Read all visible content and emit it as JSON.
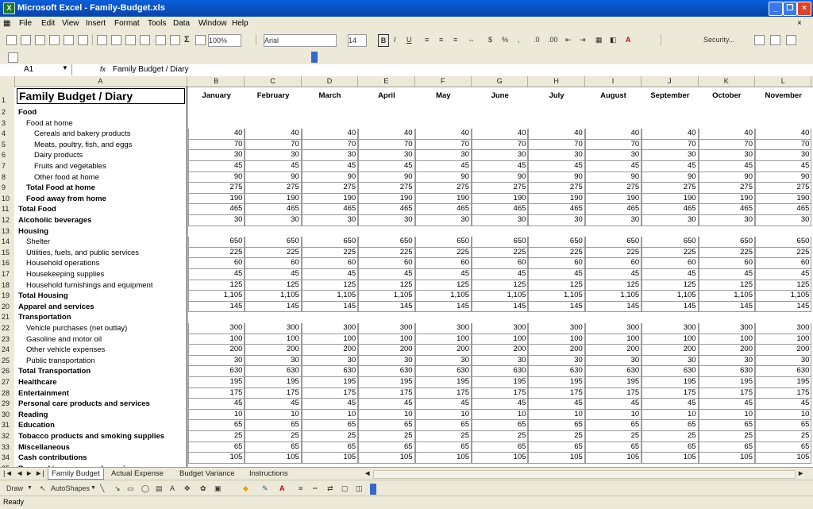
{
  "window": {
    "title": "Microsoft Excel - Family-Budget.xls",
    "icon": "excel-icon"
  },
  "menu": [
    "File",
    "Edit",
    "View",
    "Insert",
    "Format",
    "Tools",
    "Data",
    "Window",
    "Help"
  ],
  "toolbar": {
    "zoom": "100%",
    "font": "Arial",
    "font_size": "14",
    "security": "Security..."
  },
  "formula": {
    "cell_ref": "A1",
    "fx": "fx",
    "content": "Family Budget / Diary"
  },
  "columns": [
    "A",
    "B",
    "C",
    "D",
    "E",
    "F",
    "G",
    "H",
    "I",
    "J",
    "K",
    "L"
  ],
  "months": [
    "January",
    "February",
    "March",
    "April",
    "May",
    "June",
    "July",
    "August",
    "September",
    "October",
    "November"
  ],
  "title": "Family Budget / Diary",
  "rows": [
    {
      "n": "2",
      "label": "Food",
      "bold": true,
      "indent": 0,
      "value": ""
    },
    {
      "n": "3",
      "label": "Food at home",
      "bold": false,
      "indent": 1,
      "value": ""
    },
    {
      "n": "4",
      "label": "Cereals and bakery products",
      "bold": false,
      "indent": 2,
      "value": "40"
    },
    {
      "n": "5",
      "label": "Meats, poultry, fish, and eggs",
      "bold": false,
      "indent": 2,
      "value": "70"
    },
    {
      "n": "6",
      "label": "Dairy products",
      "bold": false,
      "indent": 2,
      "value": "30"
    },
    {
      "n": "7",
      "label": "Fruits and vegetables",
      "bold": false,
      "indent": 2,
      "value": "45"
    },
    {
      "n": "8",
      "label": "Other food at home",
      "bold": false,
      "indent": 2,
      "value": "90"
    },
    {
      "n": "9",
      "label": "Total Food at home",
      "bold": true,
      "indent": 1,
      "value": "275"
    },
    {
      "n": "10",
      "label": "Food away from home",
      "bold": true,
      "indent": 1,
      "value": "190"
    },
    {
      "n": "11",
      "label": "Total Food",
      "bold": true,
      "indent": 0,
      "value": "465"
    },
    {
      "n": "12",
      "label": "Alcoholic beverages",
      "bold": true,
      "indent": 0,
      "value": "30"
    },
    {
      "n": "13",
      "label": "Housing",
      "bold": true,
      "indent": 0,
      "value": ""
    },
    {
      "n": "14",
      "label": "Shelter",
      "bold": false,
      "indent": 1,
      "value": "650"
    },
    {
      "n": "15",
      "label": "Utilities, fuels, and public services",
      "bold": false,
      "indent": 1,
      "value": "225"
    },
    {
      "n": "16",
      "label": "Household operations",
      "bold": false,
      "indent": 1,
      "value": "60"
    },
    {
      "n": "17",
      "label": "Housekeeping supplies",
      "bold": false,
      "indent": 1,
      "value": "45"
    },
    {
      "n": "18",
      "label": "Household furnishings and equipment",
      "bold": false,
      "indent": 1,
      "value": "125"
    },
    {
      "n": "19",
      "label": "Total Housing",
      "bold": true,
      "indent": 0,
      "value": "1,105"
    },
    {
      "n": "20",
      "label": "Apparel and services",
      "bold": true,
      "indent": 0,
      "value": "145"
    },
    {
      "n": "21",
      "label": "Transportation",
      "bold": true,
      "indent": 0,
      "value": ""
    },
    {
      "n": "22",
      "label": "Vehicle purchases (net outlay)",
      "bold": false,
      "indent": 1,
      "value": "300"
    },
    {
      "n": "23",
      "label": "Gasoline and motor oil",
      "bold": false,
      "indent": 1,
      "value": "100"
    },
    {
      "n": "24",
      "label": "Other vehicle expenses",
      "bold": false,
      "indent": 1,
      "value": "200"
    },
    {
      "n": "25",
      "label": "Public transportation",
      "bold": false,
      "indent": 1,
      "value": "30"
    },
    {
      "n": "26",
      "label": "Total Transportation",
      "bold": true,
      "indent": 0,
      "value": "630"
    },
    {
      "n": "27",
      "label": "Healthcare",
      "bold": true,
      "indent": 0,
      "value": "195"
    },
    {
      "n": "28",
      "label": "Entertainment",
      "bold": true,
      "indent": 0,
      "value": "175"
    },
    {
      "n": "29",
      "label": "Personal care products and services",
      "bold": true,
      "indent": 0,
      "value": "45"
    },
    {
      "n": "30",
      "label": "Reading",
      "bold": true,
      "indent": 0,
      "value": "10"
    },
    {
      "n": "31",
      "label": "Education",
      "bold": true,
      "indent": 0,
      "value": "65"
    },
    {
      "n": "32",
      "label": "Tobacco products and smoking supplies",
      "bold": true,
      "indent": 0,
      "value": "25"
    },
    {
      "n": "33",
      "label": "Miscellaneous",
      "bold": true,
      "indent": 0,
      "value": "65"
    },
    {
      "n": "34",
      "label": "Cash contributions",
      "bold": true,
      "indent": 0,
      "value": "105"
    },
    {
      "n": "35",
      "label": "Personal insurance and pensions",
      "bold": true,
      "indent": 0,
      "value": ""
    }
  ],
  "sheet_tabs": [
    "Family Budget",
    "Actual Expense",
    "Budget Variance",
    "Instructions"
  ],
  "drawbar": {
    "draw": "Draw",
    "autoshapes": "AutoShapes"
  },
  "status": "Ready"
}
